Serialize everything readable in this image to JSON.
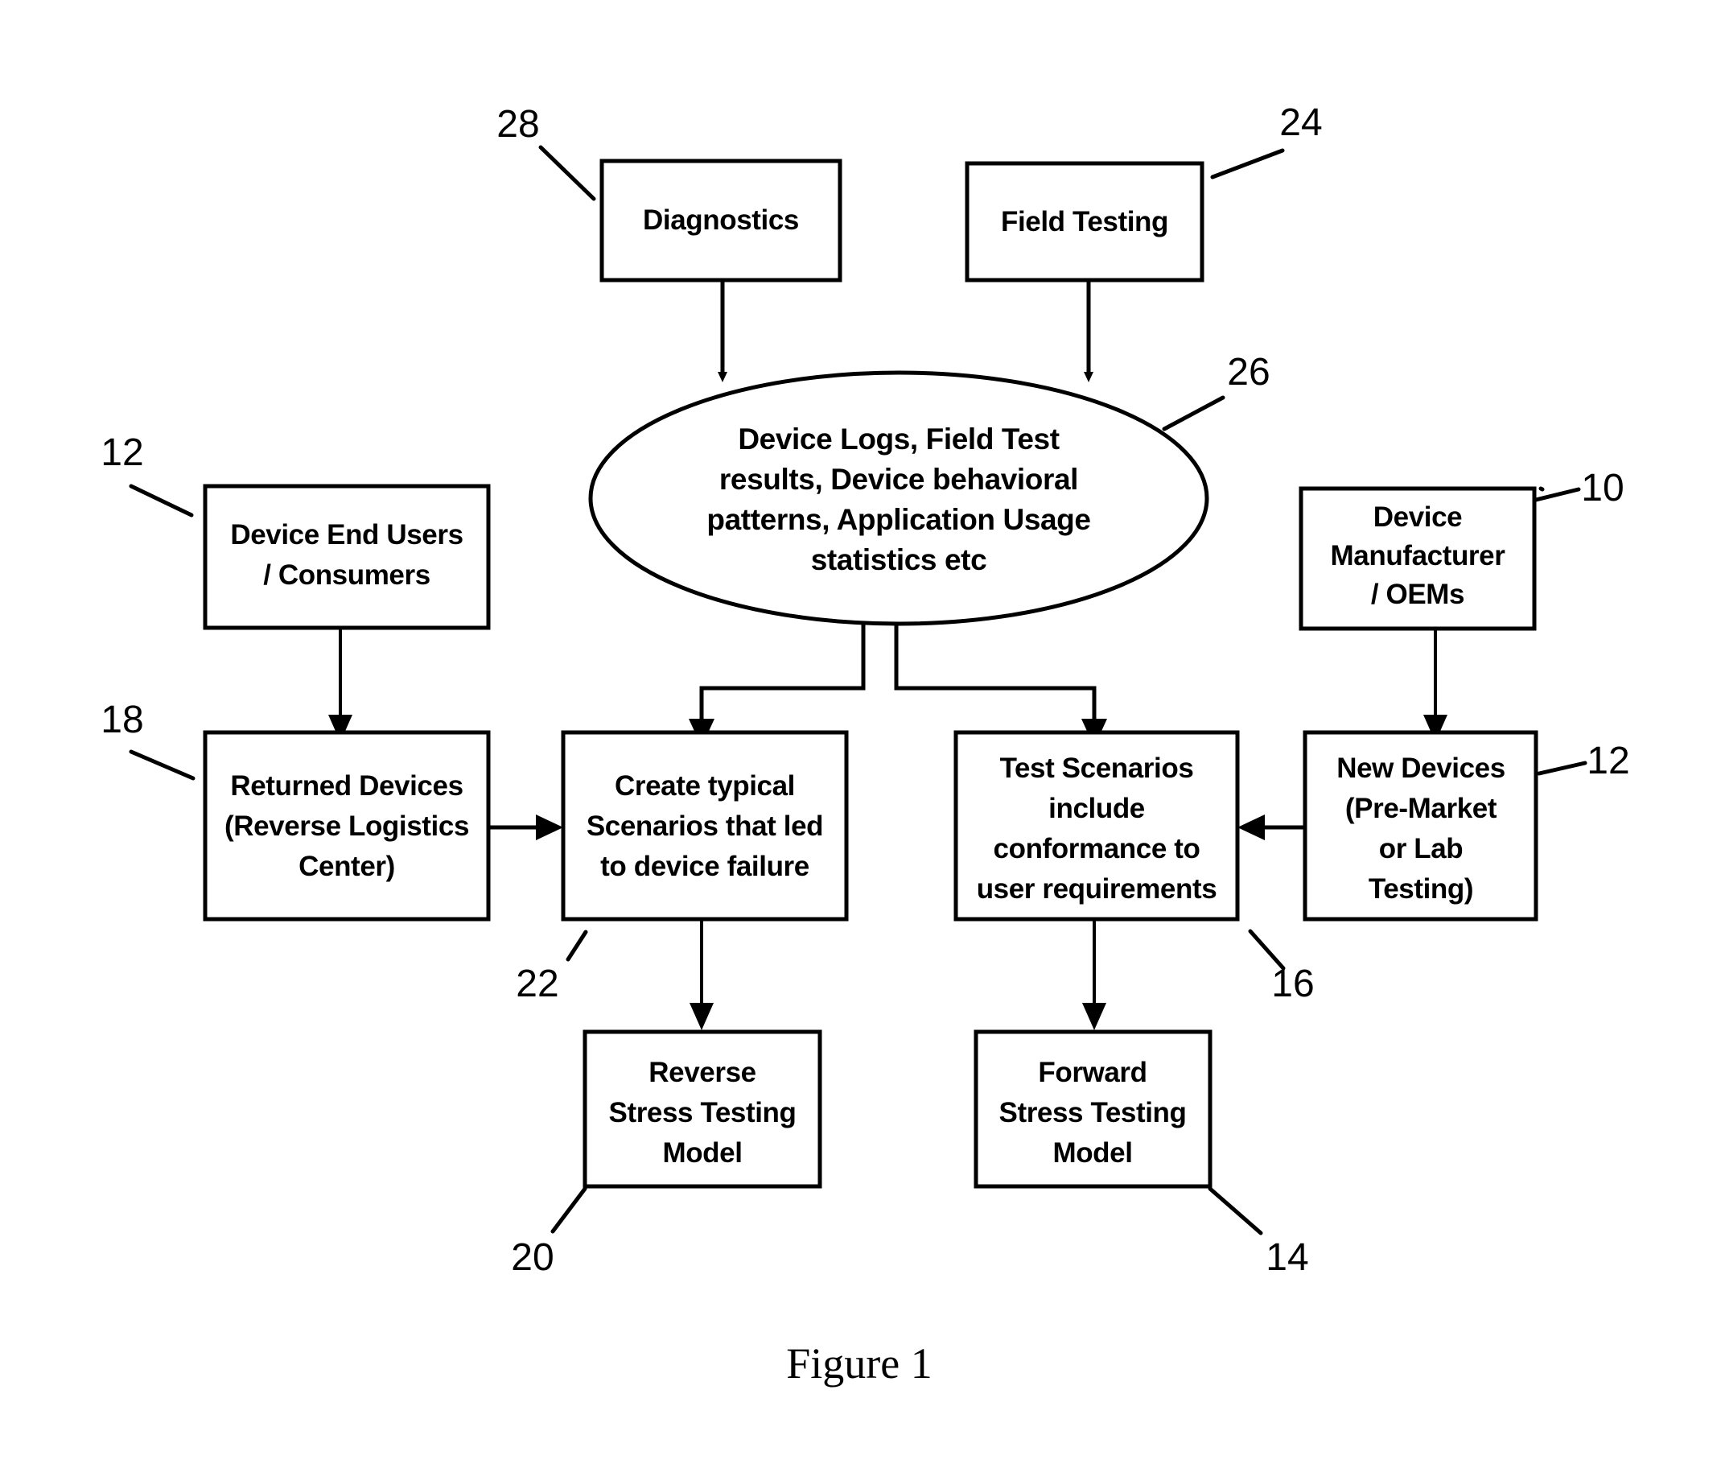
{
  "figure": {
    "caption": "Figure 1",
    "type": "patent-flow-diagram"
  },
  "nodes": {
    "diagnostics": {
      "label": "Diagnostics",
      "ref": "28",
      "shape": "rect"
    },
    "field_testing": {
      "label": "Field Testing",
      "ref": "24",
      "shape": "rect"
    },
    "data_store": {
      "ref": "26",
      "shape": "ellipse",
      "line1": "Device Logs, Field  Test",
      "line2": "results,  Device behavioral",
      "line3": "patterns,  Application  Usage",
      "line4": "statistics etc"
    },
    "end_users": {
      "ref": "12",
      "shape": "rect",
      "line1": "Device End Users",
      "line2": "/ Consumers"
    },
    "manufacturer": {
      "ref": "10",
      "shape": "rect",
      "line1": "Device",
      "line2": "Manufacturer",
      "line3": "/ OEMs"
    },
    "returned_devices": {
      "ref": "18",
      "shape": "rect",
      "line1": "Returned Devices",
      "line2": "(Reverse Logistics",
      "line3": "Center)"
    },
    "create_scenarios": {
      "ref": "22",
      "shape": "rect",
      "line1": "Create typical",
      "line2": "Scenarios  that led",
      "line3": "to device  failure"
    },
    "test_scenarios": {
      "ref": "16",
      "shape": "rect",
      "line1": "Test Scenarios",
      "line2": "include",
      "line3": "conformance to",
      "line4": "user requirements"
    },
    "new_devices": {
      "ref": "12",
      "shape": "rect",
      "line1": "New Devices",
      "line2": "(Pre-Market",
      "line3": "or Lab",
      "line4": "Testing)"
    },
    "reverse_model": {
      "ref": "20",
      "shape": "rect",
      "line1": "Reverse",
      "line2": "Stress Testing",
      "line3": "Model"
    },
    "forward_model": {
      "ref": "14",
      "shape": "rect",
      "line1": "Forward",
      "line2": "Stress Testing",
      "line3": "Model"
    }
  },
  "colors": {
    "stroke": "#000000",
    "fill": "#ffffff",
    "background": "#ffffff"
  }
}
